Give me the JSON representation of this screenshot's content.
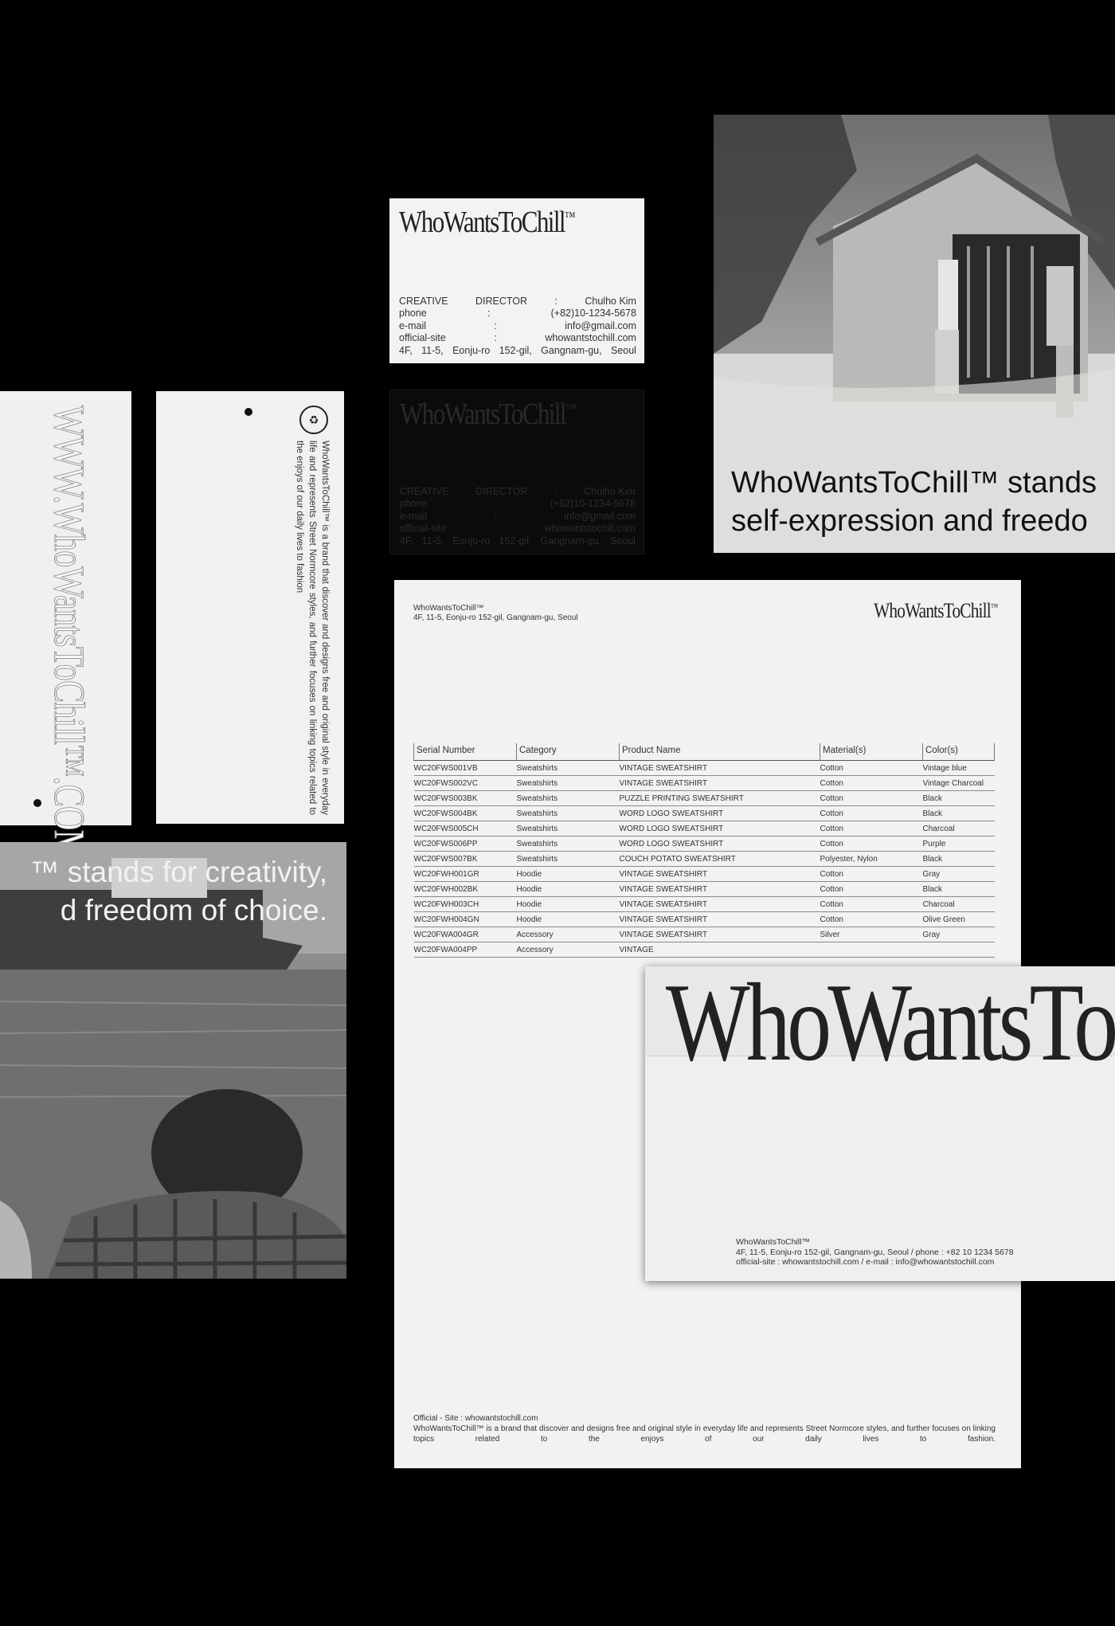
{
  "brand": {
    "name": "WhoWantsToChill",
    "tm": "™"
  },
  "business_card": {
    "rows": [
      [
        "CREATIVE",
        "DIRECTOR",
        ":",
        "Chulho Kim"
      ],
      [
        "phone",
        ":",
        "(+82)10-1234-5678"
      ],
      [
        "e-mail",
        ":",
        "info@gmail.com"
      ],
      [
        "official-site",
        ":",
        "whowantstochill.com"
      ],
      [
        "4F,",
        "11-5,",
        "Eonju-ro",
        "152-gil,",
        "Gangnam-gu,",
        "Seoul"
      ]
    ]
  },
  "poster_top": {
    "line1": "WhoWantsToChill™ stands",
    "line2": "self-expression and freedo"
  },
  "poster_left": {
    "line1": "™ stands for creativity,",
    "line2": "d freedom of choice."
  },
  "tag_url": "WWW.WhoWantsToChill™.COM",
  "tag_copy": "WhoWantsToChill™ is a brand that discover and designs free and original style in everyday life and represents Street Normcore styles, and further focuses on linking topics related to the enjoys of our daily lives to fashion",
  "letterhead": {
    "name": "WhoWantsToChill™",
    "address": "4F, 11-5, Eonju-ro 152-gil, Gangnam-gu, Seoul",
    "columns": [
      "Serial Number",
      "Category",
      "Product Name",
      "Material(s)",
      "Color(s)"
    ],
    "rows": [
      [
        "WC20FWS001VB",
        "Sweatshirts",
        "VINTAGE SWEATSHIRT",
        "Cotton",
        "Vintage blue"
      ],
      [
        "WC20FWS002VC",
        "Sweatshirts",
        "VINTAGE SWEATSHIRT",
        "Cotton",
        "Vintage Charcoal"
      ],
      [
        "WC20FWS003BK",
        "Sweatshirts",
        "PUZZLE PRINTING SWEATSHIRT",
        "Cotton",
        "Black"
      ],
      [
        "WC20FWS004BK",
        "Sweatshirts",
        "WORD LOGO SWEATSHIRT",
        "Cotton",
        "Black"
      ],
      [
        "WC20FWS005CH",
        "Sweatshirts",
        "WORD LOGO SWEATSHIRT",
        "Cotton",
        "Charcoal"
      ],
      [
        "WC20FWS006PP",
        "Sweatshirts",
        "WORD LOGO SWEATSHIRT",
        "Cotton",
        "Purple"
      ],
      [
        "WC20FWS007BK",
        "Sweatshirts",
        "COUCH POTATO SWEATSHIRT",
        "Polyester, Nylon",
        "Black"
      ],
      [
        "WC20FWH001GR",
        "Hoodie",
        "VINTAGE SWEATSHIRT",
        "Cotton",
        "Gray"
      ],
      [
        "WC20FWH002BK",
        "Hoodie",
        "VINTAGE SWEATSHIRT",
        "Cotton",
        "Black"
      ],
      [
        "WC20FWH003CH",
        "Hoodie",
        "VINTAGE SWEATSHIRT",
        "Cotton",
        "Charcoal"
      ],
      [
        "WC20FWH004GN",
        "Hoodie",
        "VINTAGE SWEATSHIRT",
        "Cotton",
        "Olive Green"
      ],
      [
        "WC20FWA004GR",
        "Accessory",
        "VINTAGE SWEATSHIRT",
        "Silver",
        "Gray"
      ],
      [
        "WC20FWA004PP",
        "Accessory",
        "VINTAGE",
        "",
        ""
      ]
    ],
    "footer_site": "Official - Site : whowantstochill.com",
    "footer_copy": "WhoWantsToChill™ is a brand that discover and designs free and original style in everyday life and represents Street Normcore styles, and further focuses on linking topics related to the enjoys of our daily lives to fashion."
  },
  "envelope": {
    "big_text": "WhoWantsToC",
    "line1": "WhoWantsToChill™",
    "line2": "4F, 11-5, Eonju-ro 152-gil, Gangnam-gu, Seoul / phone : +82 10 1234 5678",
    "line3": "official-site : whowantstochill.com / e-mail : info@whowantstochill.com"
  }
}
